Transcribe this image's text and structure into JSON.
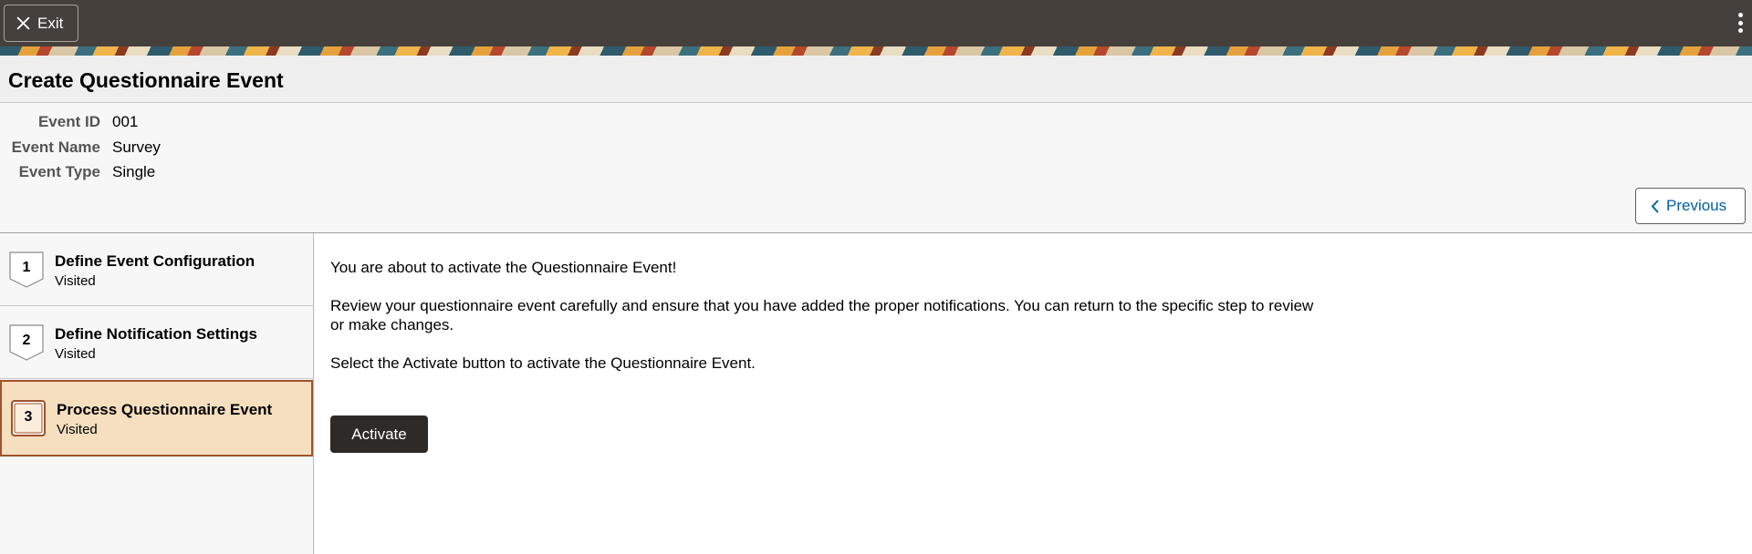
{
  "topbar": {
    "exit_label": "Exit"
  },
  "page": {
    "title": "Create Questionnaire Event"
  },
  "header": {
    "fields": [
      {
        "label": "Event ID",
        "value": "001"
      },
      {
        "label": "Event Name",
        "value": "Survey"
      },
      {
        "label": "Event Type",
        "value": "Single"
      }
    ],
    "previous_label": "Previous"
  },
  "steps": [
    {
      "number": "1",
      "title": "Define Event Configuration",
      "status": "Visited"
    },
    {
      "number": "2",
      "title": "Define Notification Settings",
      "status": "Visited"
    },
    {
      "number": "3",
      "title": "Process Questionnaire Event",
      "status": "Visited",
      "active": true
    }
  ],
  "main": {
    "line1": "You are about to activate the Questionnaire Event!",
    "line2": "Review your questionnaire event carefully and ensure that you have added the proper notifications. You can return to the specific step to review or make changes.",
    "line3": "Select the Activate button to activate the Questionnaire Event.",
    "activate_label": "Activate"
  },
  "colors": {
    "topbar": "#45403c",
    "active_step_bg": "#f6dfbf",
    "active_step_border": "#a0522d",
    "link": "#0060a8",
    "primary_button": "#2e2a27"
  }
}
